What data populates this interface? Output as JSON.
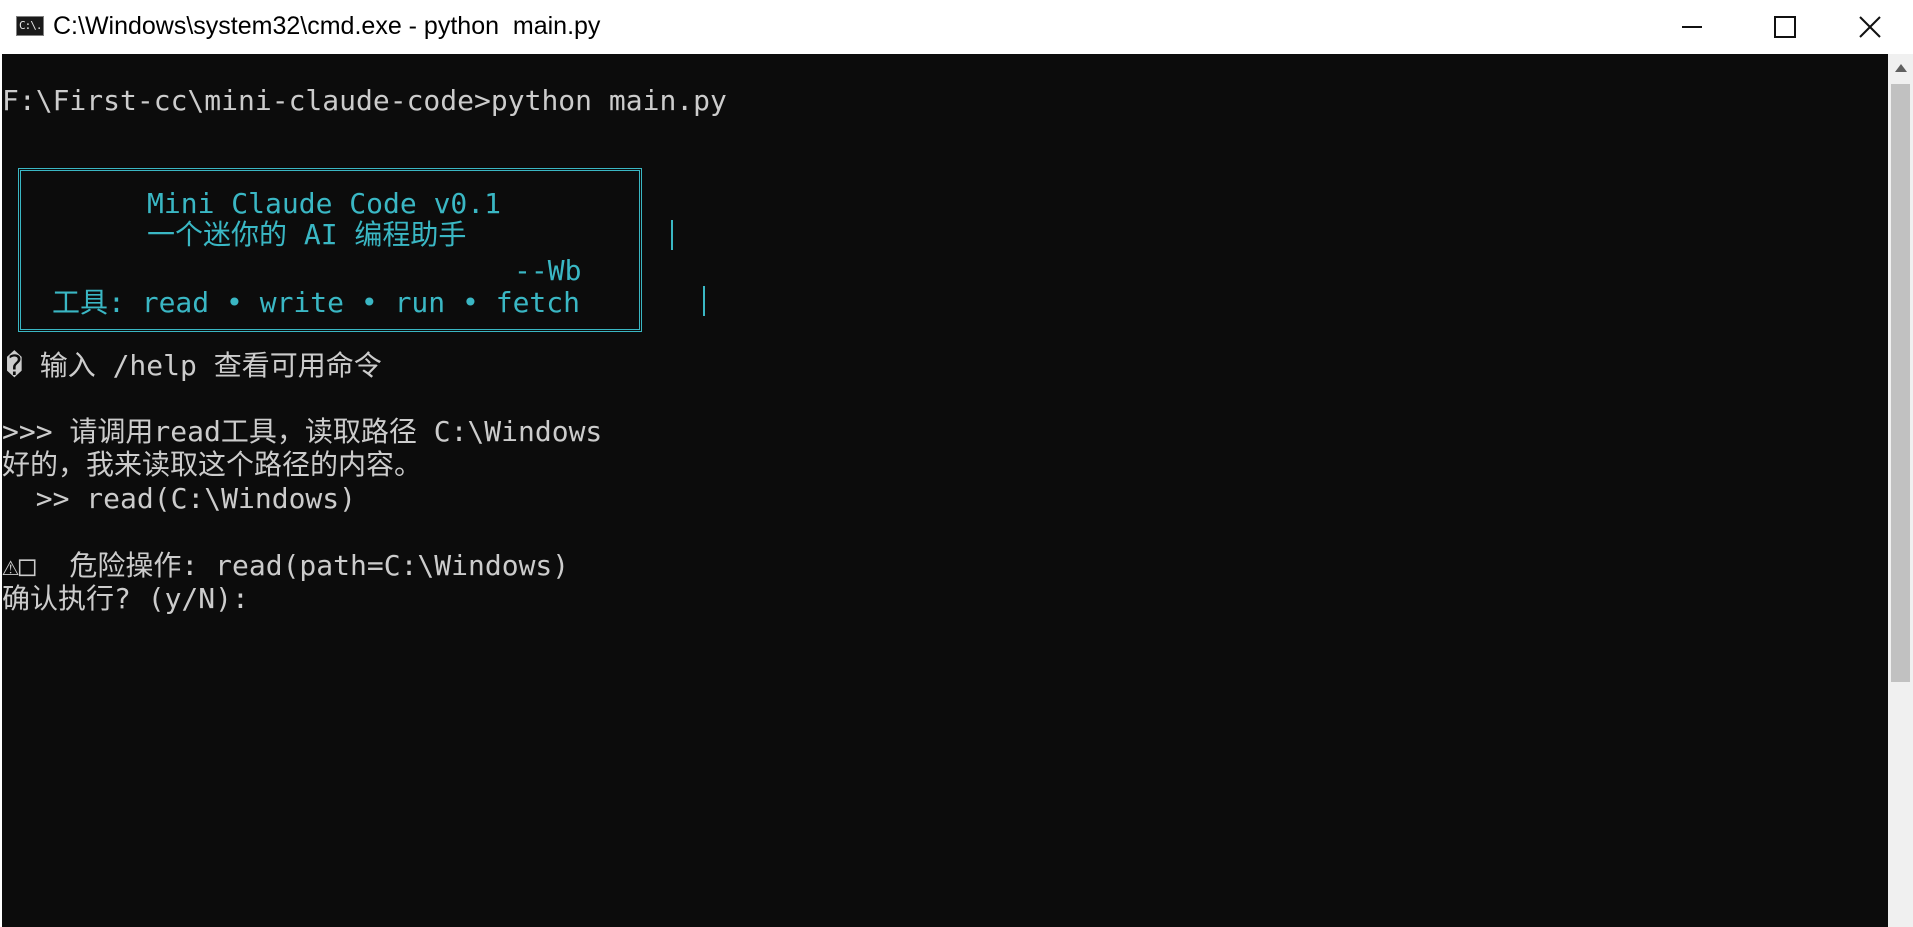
{
  "window": {
    "title": "C:\\Windows\\system32\\cmd.exe - python  main.py",
    "icon": "cmd-icon",
    "icon_glyph": "C:\\."
  },
  "console": {
    "command_line": "F:\\First-cc\\mini-claude-code>python main.py",
    "banner": {
      "title": "Mini Claude Code v0.1",
      "subtitle": "一个迷你的 AI 编程助手",
      "author": "--Wb",
      "tools": "工具: read • write • run • fetch"
    },
    "help_hint": "� 输入 /help 查看可用命令",
    "user_input": ">>> 请调用read工具，读取路径 C:\\Windows",
    "assistant_reply": "好的，我来读取这个路径的内容。",
    "tool_call": "  >> read(C:\\Windows)",
    "warning": "⚠□  危险操作: read(path=C:\\Windows)",
    "confirm_prompt": "确认执行? (y/N): "
  },
  "colors": {
    "console_bg": "#0c0c0c",
    "console_text": "#cccccc",
    "banner_accent": "#3ab7c4"
  }
}
